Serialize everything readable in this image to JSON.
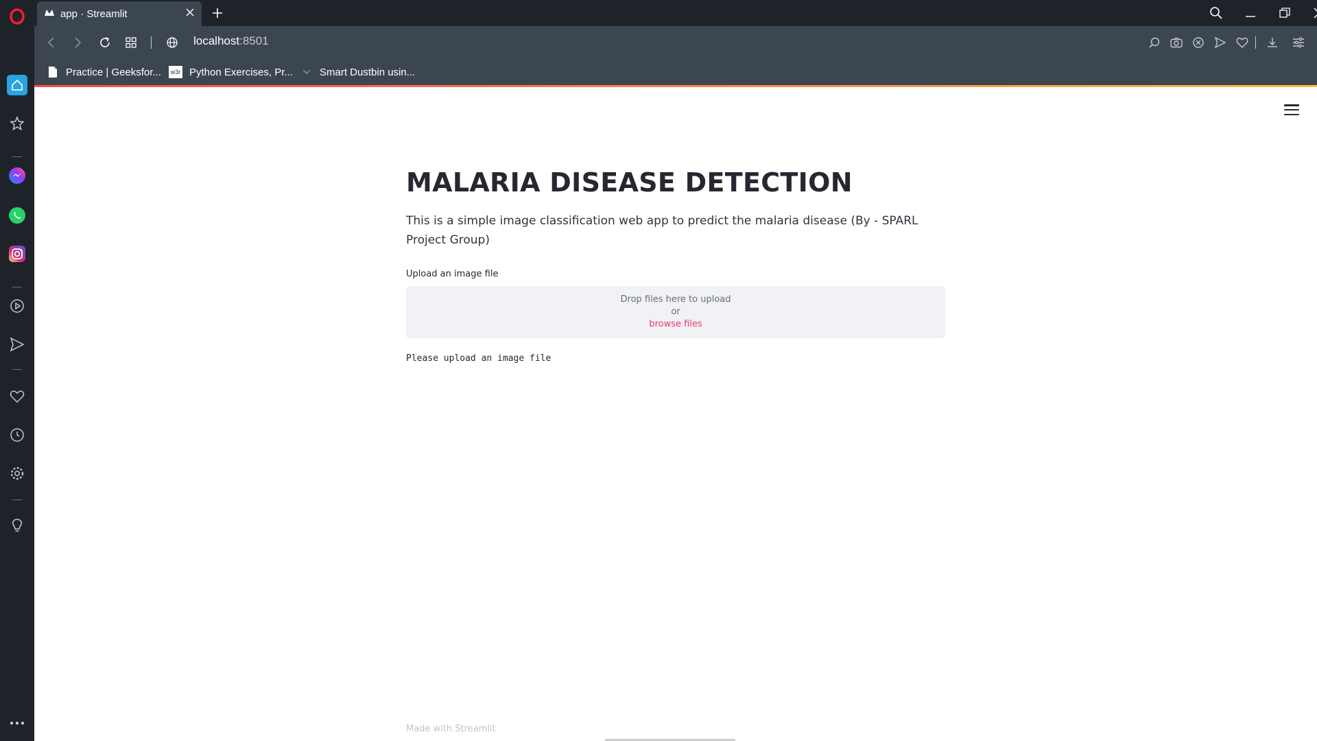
{
  "browser": {
    "tab_title": "app · Streamlit",
    "url_host": "localhost",
    "url_port": ":8501",
    "bookmarks": [
      {
        "label": "Practice | Geeksfor...",
        "icon": "page-icon"
      },
      {
        "label": "Python Exercises, Pr...",
        "icon": "w3schools-icon",
        "icon_text": "w3r"
      },
      {
        "label": "Smart Dustbin usin...",
        "icon": "bookmark-favicon"
      }
    ]
  },
  "app": {
    "title": "MALARIA DISEASE DETECTION",
    "description": "This is a simple image classification web app to predict the malaria disease (By - SPARL Project Group)",
    "upload_label": "Upload an image file",
    "dropzone_text": "Drop files here to upload",
    "dropzone_or": "or",
    "browse_label": "browse files",
    "status_message": "Please upload an image file",
    "footer": "Made with Streamlit"
  },
  "colors": {
    "browser_dark": "#1e2329",
    "browser_bar": "#3c4650",
    "accent_red": "#f63366",
    "dropzone_bg": "#f0f2f6",
    "text_dark": "#262730"
  }
}
